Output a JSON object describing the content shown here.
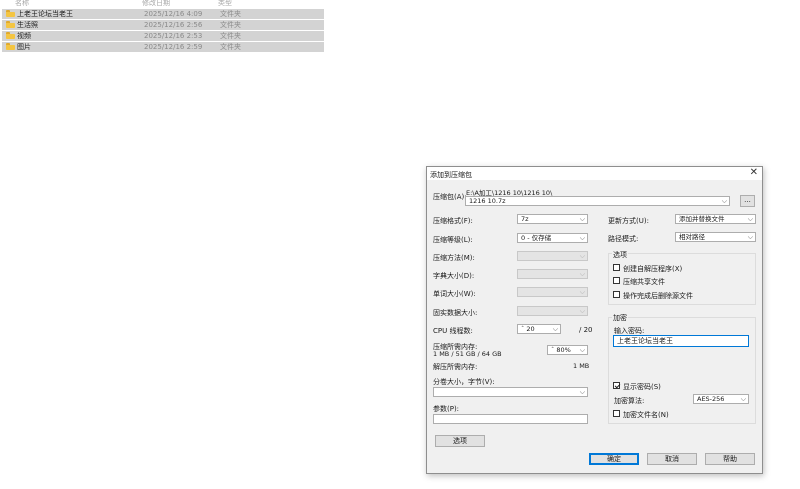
{
  "explorer": {
    "header": {
      "name": "名称",
      "date": "修改日期",
      "type": "类型"
    },
    "rows": [
      {
        "name": "上老王论坛当老王",
        "date": "2025/12/16 4:09",
        "type": "文件夹"
      },
      {
        "name": "生活照",
        "date": "2025/12/16 2:56",
        "type": "文件夹"
      },
      {
        "name": "视频",
        "date": "2025/12/16 2:53",
        "type": "文件夹"
      },
      {
        "name": "图片",
        "date": "2025/12/16 2:59",
        "type": "文件夹"
      }
    ]
  },
  "dialog": {
    "title": "添加到压缩包",
    "close": "✕",
    "archive": {
      "label": "压缩包(A):",
      "path": "E:\\A加工\\1216 10\\1216 10\\",
      "filename": "1216 10.7z",
      "browse": "..."
    },
    "left": {
      "format": {
        "label": "压缩格式(F):",
        "value": "7z"
      },
      "level": {
        "label": "压缩等级(L):",
        "value": "0 - 仅存储"
      },
      "method": {
        "label": "压缩方法(M):",
        "value": ""
      },
      "dict": {
        "label": "字典大小(D):",
        "value": ""
      },
      "word": {
        "label": "单词大小(W):",
        "value": ""
      },
      "solid": {
        "label": "固实数据大小:",
        "value": ""
      },
      "cpu": {
        "label": "CPU 线程数:",
        "value": "20",
        "total": "/ 20"
      },
      "mem_compress": {
        "label": "压缩所需内存:",
        "detail": "1 MB / 51 GB / 64 GB",
        "percent": "80%"
      },
      "mem_decompress": {
        "label": "解压所需内存:",
        "value": "1 MB"
      },
      "split": {
        "label": "分卷大小，字节(V):",
        "value": ""
      },
      "params": {
        "label": "参数(P):",
        "value": ""
      },
      "options_button": "选项"
    },
    "right": {
      "update": {
        "label": "更新方式(U):",
        "value": "添加并替换文件"
      },
      "pathmode": {
        "label": "路径模式:",
        "value": "相对路径"
      },
      "options_group": {
        "title": "选项",
        "items": [
          {
            "label": "创建自解压程序(X)",
            "checked": false
          },
          {
            "label": "压缩共享文件",
            "checked": false
          },
          {
            "label": "操作完成后删除源文件",
            "checked": false
          }
        ]
      },
      "encrypt_group": {
        "title": "加密",
        "pwd_label": "输入密码:",
        "pwd_value": "上老王论坛当老王",
        "show_pwd": {
          "label": "显示密码(S)",
          "checked": true
        },
        "algo": {
          "label": "加密算法:",
          "value": "AES-256"
        },
        "encrypt_names": {
          "label": "加密文件名(N)",
          "checked": false
        }
      }
    },
    "buttons": {
      "ok": "确定",
      "cancel": "取消",
      "help": "帮助"
    }
  }
}
